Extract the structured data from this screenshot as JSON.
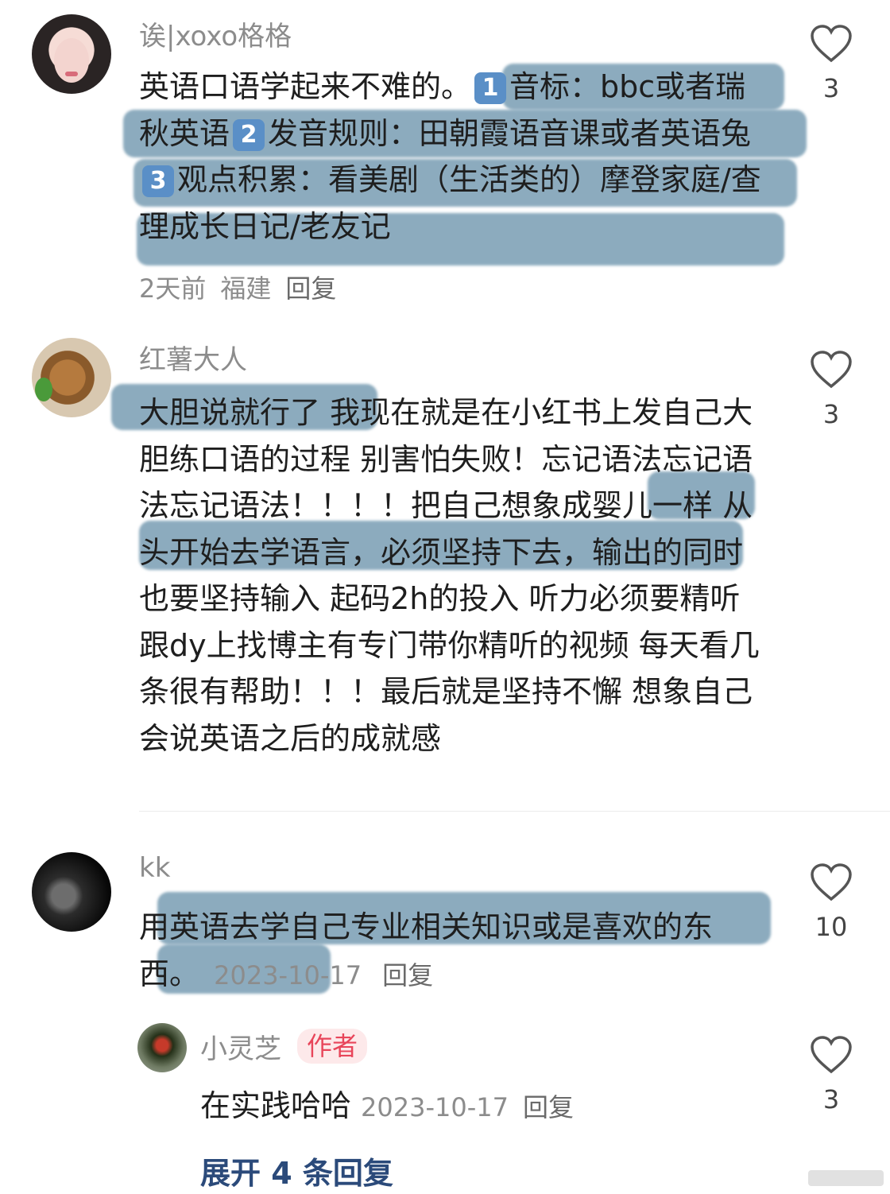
{
  "comments": [
    {
      "username": "诶|xoxo格格",
      "text_before": "英语口语学起来不难的。",
      "seg1_marker": "1",
      "seg1": "音标：bbc或者瑞秋英语",
      "seg2_marker": "2",
      "seg2": "发音规则：田朝霞语音课或者英语兔",
      "seg3_marker": "3",
      "seg3": "观点积累：看美剧（生活类的）摩登家庭/查理成长日记/老友记",
      "time": "2天前",
      "location": "福建",
      "reply": "回复",
      "likes": "3"
    },
    {
      "username": "红薯大人",
      "text": "大胆说就行了 我现在就是在小红书上发自己大胆练口语的过程 别害怕失败！忘记语法忘记语法忘记语法！！！！把自己想象成婴儿一样 从头开始去学语言，必须坚持下去，输出的同时也要坚持输入 起码2h的投入 听力必须要精听 跟dy上找博主有专门带你精听的视频 每天看几条很有帮助！！！最后就是坚持不懈 想象自己会说英语之后的成就感",
      "likes": "3"
    },
    {
      "username": "kk",
      "text": "用英语去学自己专业相关知识或是喜欢的东西。",
      "time": "2023-10-17",
      "reply": "回复",
      "likes": "10"
    }
  ],
  "sub_reply": {
    "username": "小灵芝",
    "badge": "作者",
    "text": "在实践哈哈",
    "time": "2023-10-17",
    "reply": "回复",
    "likes": "3"
  },
  "expand_label": "展开 4 条回复"
}
